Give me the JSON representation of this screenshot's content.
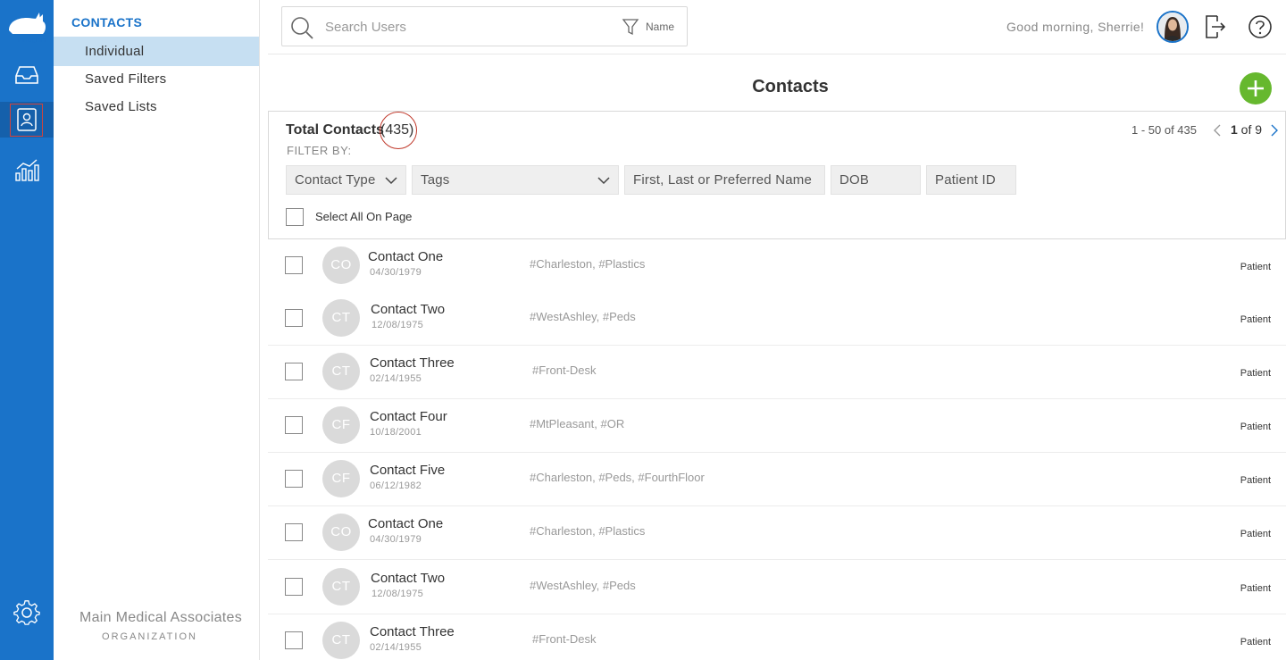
{
  "app": {
    "logo_text": "rhinogram"
  },
  "sidebar": {
    "section_title": "CONTACTS",
    "items": [
      {
        "label": "Individual",
        "active": true
      },
      {
        "label": "Saved Filters",
        "active": false
      },
      {
        "label": "Saved Lists",
        "active": false
      }
    ],
    "org_name": "Main Medical Associates",
    "org_label": "ORGANIZATION"
  },
  "rail": {
    "icons": [
      "inbox-icon",
      "contacts-icon",
      "analytics-icon",
      "settings-icon"
    ],
    "active": "contacts-icon"
  },
  "topbar": {
    "search_placeholder": "Search Users",
    "filter_label": "Name",
    "greeting": "Good morning, Sherrie!"
  },
  "page": {
    "title": "Contacts"
  },
  "panel": {
    "total_label": "Total Contacts",
    "total_count": "(435)",
    "filter_by": "FILTER BY:",
    "paging_range": "1 - 50 of 435",
    "page_current": "1",
    "page_of": " of 9",
    "filters": {
      "contact_type": "Contact Type",
      "tags": "Tags",
      "name": "First, Last or Preferred Name",
      "dob": "DOB",
      "patient_id": "Patient ID"
    },
    "select_all": "Select All On Page"
  },
  "contacts": [
    {
      "initials": "CO",
      "name": "Contact One",
      "dob": "04/30/1979",
      "tags": "#Charleston, #Plastics",
      "type": "Patient"
    },
    {
      "initials": "CT",
      "name": "Contact Two",
      "dob": "12/08/1975",
      "tags": "#WestAshley, #Peds",
      "type": "Patient"
    },
    {
      "initials": "CT",
      "name": "Contact Three",
      "dob": "02/14/1955",
      "tags": "#Front-Desk",
      "type": "Patient"
    },
    {
      "initials": "CF",
      "name": "Contact Four",
      "dob": "10/18/2001",
      "tags": "#MtPleasant, #OR",
      "type": "Patient"
    },
    {
      "initials": "CF",
      "name": "Contact Five",
      "dob": "06/12/1982",
      "tags": "#Charleston, #Peds, #FourthFloor",
      "type": "Patient"
    },
    {
      "initials": "CO",
      "name": "Contact One",
      "dob": "04/30/1979",
      "tags": "#Charleston, #Plastics",
      "type": "Patient"
    },
    {
      "initials": "CT",
      "name": "Contact Two",
      "dob": "12/08/1975",
      "tags": "#WestAshley, #Peds",
      "type": "Patient"
    },
    {
      "initials": "CT",
      "name": "Contact Three",
      "dob": "02/14/1955",
      "tags": "#Front-Desk",
      "type": "Patient"
    }
  ],
  "colors": {
    "brand": "#1a73c9",
    "add_button": "#66b82e",
    "highlight_circle": "#c0392b",
    "active_sidebar": "#c6dff2"
  }
}
